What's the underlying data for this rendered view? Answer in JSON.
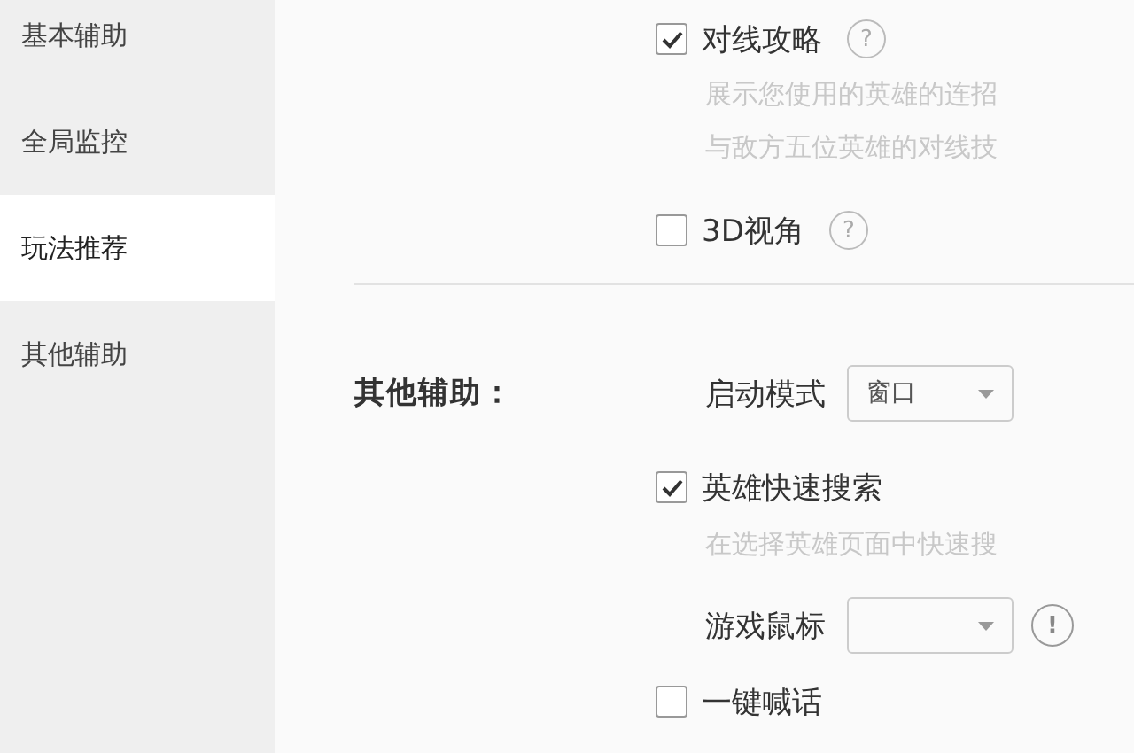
{
  "sidebar": {
    "items": [
      {
        "label": "基本辅助",
        "selected": false
      },
      {
        "label": "全局监控",
        "selected": false
      },
      {
        "label": "玩法推荐",
        "selected": true
      },
      {
        "label": "其他辅助",
        "selected": false
      }
    ]
  },
  "top_options": [
    {
      "kind": "checkbox",
      "label": "对线攻略",
      "checked": true,
      "help": "?",
      "description": [
        "展示您使用的英雄的连招",
        "与敌方五位英雄的对线技"
      ]
    },
    {
      "kind": "checkbox",
      "label": "3D视角",
      "checked": false,
      "help": "?"
    }
  ],
  "section": {
    "title": "其他辅助：",
    "options": [
      {
        "kind": "dropdown",
        "label": "启动模式",
        "value": "窗口"
      },
      {
        "kind": "checkbox",
        "label": "英雄快速搜索",
        "checked": true,
        "description": [
          "在选择英雄页面中快速搜"
        ]
      },
      {
        "kind": "dropdown",
        "label": "游戏鼠标",
        "info": "!"
      },
      {
        "kind": "checkbox",
        "label": "一键喊话",
        "checked": false
      }
    ]
  }
}
